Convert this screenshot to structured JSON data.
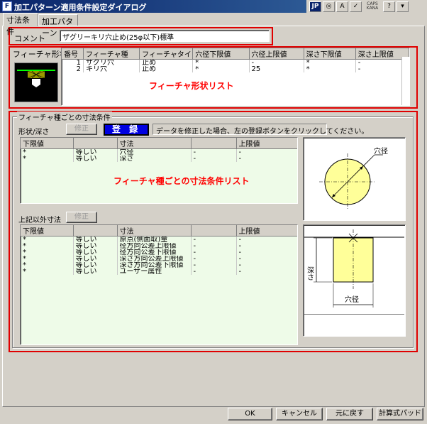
{
  "window": {
    "title": "加工パターン適用条件設定ダイアログ",
    "app_icon_letter": "F"
  },
  "ime": {
    "mode": "JP",
    "caps": "CAPS",
    "kana": "KANA"
  },
  "tabs": [
    {
      "label": "寸法条件",
      "active": true
    },
    {
      "label": "加工パターン",
      "active": false
    }
  ],
  "comment": {
    "label": "コメント",
    "value": "ザグリーキリ穴止め(25φ以下)標準"
  },
  "feature_shape": {
    "label": "フィーチャ形状",
    "columns": [
      "番号",
      "フィーチャ種",
      "フィーチャタイプ",
      "穴径下限値",
      "穴径上限値",
      "深さ下限値",
      "深さ上限値"
    ],
    "rows": [
      [
        "1",
        "ザグリ穴",
        "止め",
        "*",
        "-",
        "*",
        "-"
      ],
      [
        "2",
        "キリ穴",
        "止め",
        "*",
        "25",
        "*",
        "-"
      ]
    ],
    "annotation": "フィーチャ形状リスト"
  },
  "dims_group": {
    "title": "フィーチャ種ごとの寸法条件",
    "shape_depth_label": "形状/深さ",
    "edit_label": "修正",
    "register_label": "登 録",
    "message": "データを修正した場合、左の登録ボタンをクリックしてください。",
    "upper_columns": [
      "下限値",
      "",
      "寸法",
      "",
      "上限値"
    ],
    "upper_rows": [
      [
        "*",
        "等しい",
        "穴径",
        "-",
        "-"
      ],
      [
        "*",
        "等しい",
        "深さ",
        "-",
        "-"
      ]
    ],
    "annotation": "フィーチャ種ごとの寸法条件リスト",
    "other_label": "上記以外寸法",
    "other_edit_label": "修正",
    "lower_columns": [
      "下限値",
      "",
      "寸法",
      "",
      "上限値"
    ],
    "lower_rows": [
      [
        "*",
        "等しい",
        "原点(側面取)量",
        "-",
        "-"
      ],
      [
        "*",
        "等しい",
        "径方向公差上限値",
        "-",
        "-"
      ],
      [
        "*",
        "等しい",
        "径方向公差下限値",
        "-",
        "-"
      ],
      [
        "*",
        "等しい",
        "深さ方向公差上限値",
        "-",
        "-"
      ],
      [
        "*",
        "等しい",
        "深さ方向公差下限値",
        "-",
        "-"
      ],
      [
        "*",
        "等しい",
        "ユーザー属性",
        "-",
        "-"
      ]
    ],
    "diagram_top_label": "穴径",
    "diagram_side_label": "深さ",
    "diagram_bottom_label": "穴径"
  },
  "footer": {
    "ok": "OK",
    "cancel": "キャンセル",
    "reset": "元に戻す",
    "calc_pad": "計算式パッド"
  },
  "colors": {
    "title_bar": "#0a246a",
    "highlight_red": "#e00000",
    "register_blue": "#0000e0",
    "list_green": "#eefbe8",
    "diagram_yellow": "#ffff99"
  }
}
